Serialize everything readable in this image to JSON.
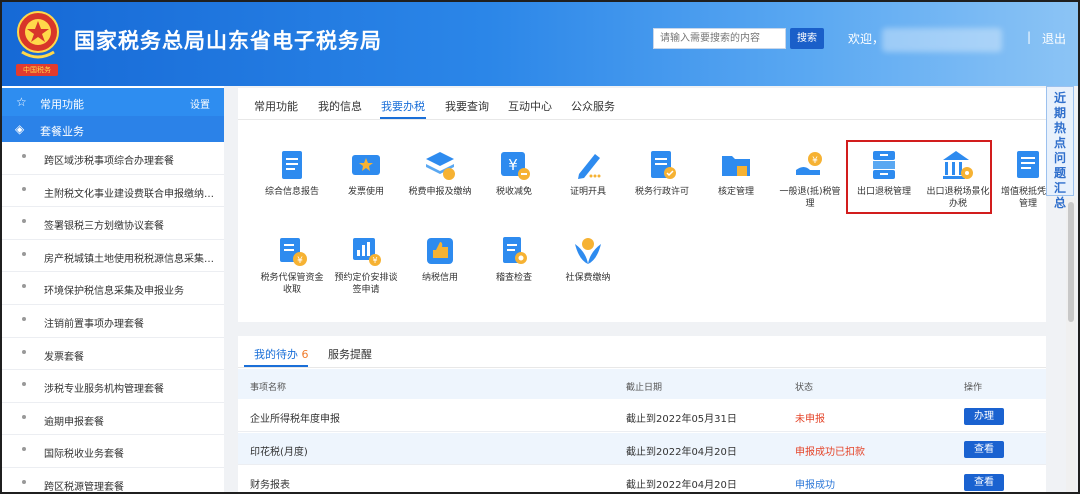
{
  "header": {
    "emblem_caption": "中国税务",
    "title": "国家税务总局山东省电子税务局",
    "search_placeholder": "请输入需要搜索的内容",
    "search_button": "搜索",
    "welcome": "欢迎，",
    "separator": "|",
    "logout": "退出"
  },
  "sidebar": {
    "common_label": "常用功能",
    "settings_label": "设置",
    "package_label": "套餐业务",
    "items": [
      "跨区域涉税事项综合办理套餐",
      "主附税文化事业建设费联合申报缴纳套餐",
      "签署银税三方划缴协议套餐",
      "房产税城镇土地使用税税源信息采集及申...",
      "环境保护税信息采集及申报业务",
      "注销前置事项办理套餐",
      "发票套餐",
      "涉税专业服务机构管理套餐",
      "逾期申报套餐",
      "国际税收业务套餐",
      "跨区税源管理套餐"
    ]
  },
  "tabs": [
    "常用功能",
    "我的信息",
    "我要办税",
    "我要查询",
    "互动中心",
    "公众服务"
  ],
  "services_row1": [
    {
      "label": "综合信息报告",
      "icon": "report-icon"
    },
    {
      "label": "发票使用",
      "icon": "invoice-icon"
    },
    {
      "label": "税费申报及缴纳",
      "icon": "declare-icon"
    },
    {
      "label": "税收减免",
      "icon": "tax-relief-icon"
    },
    {
      "label": "证明开具",
      "icon": "certificate-icon"
    },
    {
      "label": "税务行政许可",
      "icon": "permit-icon"
    },
    {
      "label": "核定管理",
      "icon": "folder-icon"
    },
    {
      "label": "一般退(抵)税管理",
      "icon": "refund-icon"
    },
    {
      "label": "出口退税管理",
      "icon": "export-refund-icon"
    },
    {
      "label": "出口退税场景化办税",
      "icon": "export-scene-icon"
    },
    {
      "label": "增值税抵凭证管理",
      "icon": "vat-icon"
    }
  ],
  "services_row2": [
    {
      "label": "税务代保管资金收取",
      "icon": "custody-icon"
    },
    {
      "label": "预约定价安排谈签申请",
      "icon": "pricing-icon"
    },
    {
      "label": "纳税信用",
      "icon": "credit-icon"
    },
    {
      "label": "稽查检查",
      "icon": "inspection-icon"
    },
    {
      "label": "社保费缴纳",
      "icon": "social-security-icon"
    }
  ],
  "side_float": "近期热点问题汇总",
  "todo": {
    "tab_pending": "我的待办",
    "pending_count": "6",
    "tab_reminder": "服务提醒",
    "columns": [
      "事项名称",
      "截止日期",
      "状态",
      "操作"
    ],
    "rows": [
      {
        "name": "企业所得税年度申报",
        "deadline": "截止到2022年05月31日",
        "status": "未申报",
        "action": "办理"
      },
      {
        "name": "印花税(月度)",
        "deadline": "截止到2022年04月20日",
        "status": "申报成功已扣款",
        "action": "查看"
      },
      {
        "name": "财务报表",
        "deadline": "截止到2022年04月20日",
        "status": "申报成功",
        "action": "查看"
      }
    ]
  },
  "colors": {
    "brand_blue": "#1a6fd8",
    "highlight_red": "#d21d1d",
    "status_red": "#e5452a"
  }
}
